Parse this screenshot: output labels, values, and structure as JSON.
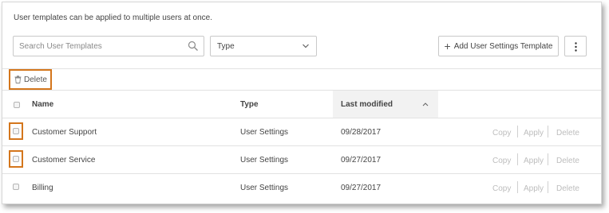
{
  "intro_text": "User templates can be applied to multiple users at once.",
  "search": {
    "placeholder": "Search User Templates",
    "icon": "search-icon"
  },
  "type_filter": {
    "value": "Type",
    "icon": "chevron-down-icon"
  },
  "add_button": {
    "label": "Add User Settings Template",
    "icon": "plus-icon"
  },
  "more_button": {
    "icon": "more-vertical-icon"
  },
  "delete_button": {
    "label": "Delete",
    "icon": "trash-icon"
  },
  "table": {
    "columns": {
      "name": "Name",
      "type": "Type",
      "last_modified": "Last modified"
    },
    "sort": {
      "column": "Last modified",
      "direction": "ascending",
      "icon": "chevron-up-icon"
    },
    "rows": [
      {
        "name": "Customer Support",
        "type": "User Settings",
        "last_modified": "09/28/2017",
        "actions": [
          "Copy",
          "Apply",
          "Delete"
        ]
      },
      {
        "name": "Customer Service",
        "type": "User Settings",
        "last_modified": "09/27/2017",
        "actions": [
          "Copy",
          "Apply",
          "Delete"
        ]
      },
      {
        "name": "Billing",
        "type": "User Settings",
        "last_modified": "09/27/2017",
        "actions": [
          "Copy",
          "Apply",
          "Delete"
        ]
      }
    ]
  },
  "colors": {
    "highlight": "#d4761c",
    "border": "#c9c9c9",
    "disabled_action": "#bdbdbd",
    "sorted_header_bg": "#f2f2f2"
  }
}
